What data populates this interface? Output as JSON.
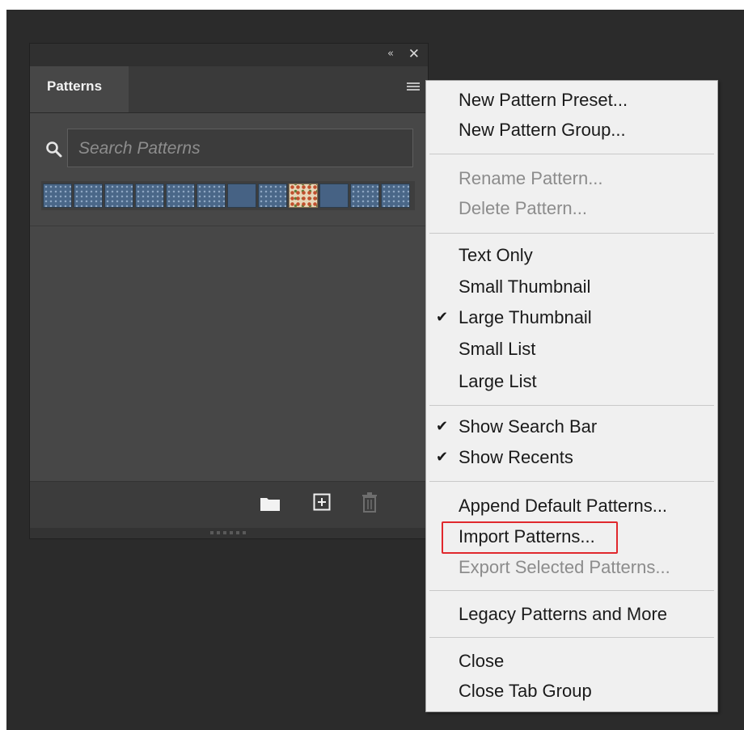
{
  "panel": {
    "collapse_glyph": "«",
    "close_glyph": "✕",
    "tab_label": "Patterns",
    "menu_icon": "hamburger-icon",
    "search": {
      "placeholder": "Search Patterns",
      "icon": "search-icon"
    },
    "recents": [
      "pattern",
      "pattern",
      "pattern",
      "pattern",
      "pattern",
      "pattern",
      "plain",
      "pattern",
      "floral",
      "plain",
      "pattern",
      "pattern"
    ],
    "footer_icons": [
      "folder-icon",
      "new-pattern-icon",
      "trash-icon"
    ]
  },
  "menu": {
    "items": [
      {
        "label": "New Pattern Preset...",
        "enabled": true,
        "checked": false
      },
      {
        "label": "New Pattern Group...",
        "enabled": true,
        "checked": false
      },
      {
        "label": "Rename Pattern...",
        "enabled": false,
        "checked": false
      },
      {
        "label": "Delete Pattern...",
        "enabled": false,
        "checked": false
      },
      {
        "label": "Text Only",
        "enabled": true,
        "checked": false
      },
      {
        "label": "Small Thumbnail",
        "enabled": true,
        "checked": false
      },
      {
        "label": "Large Thumbnail",
        "enabled": true,
        "checked": true
      },
      {
        "label": "Small List",
        "enabled": true,
        "checked": false
      },
      {
        "label": "Large List",
        "enabled": true,
        "checked": false
      },
      {
        "label": "Show Search Bar",
        "enabled": true,
        "checked": true
      },
      {
        "label": "Show Recents",
        "enabled": true,
        "checked": true
      },
      {
        "label": "Append Default Patterns...",
        "enabled": true,
        "checked": false
      },
      {
        "label": "Import Patterns...",
        "enabled": true,
        "checked": false,
        "highlighted": true
      },
      {
        "label": "Export Selected Patterns...",
        "enabled": false,
        "checked": false
      },
      {
        "label": "Legacy Patterns and More",
        "enabled": true,
        "checked": false
      },
      {
        "label": "Close",
        "enabled": true,
        "checked": false
      },
      {
        "label": "Close Tab Group",
        "enabled": true,
        "checked": false
      }
    ],
    "check_glyph": "✔",
    "highlight_color": "#e0282d"
  },
  "colors": {
    "workspace": "#2b2b2b",
    "panel": "#474747",
    "menu": "#f0f0f0"
  }
}
